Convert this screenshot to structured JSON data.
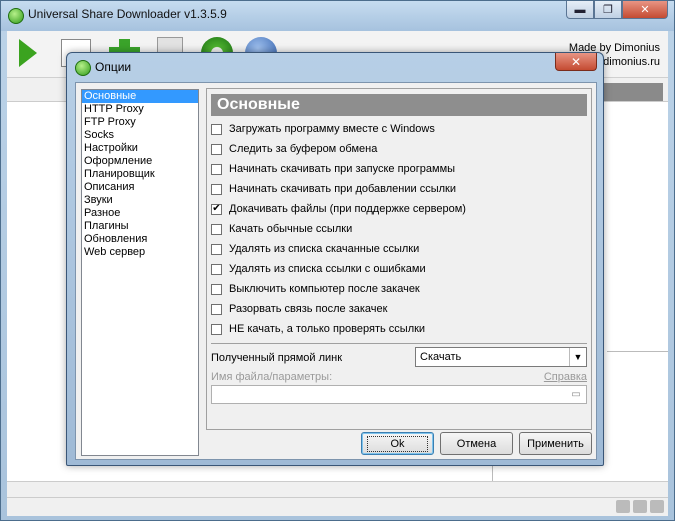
{
  "app": {
    "title": "Universal Share Downloader v1.3.5.9",
    "made_by_line1": "Made by Dimonius",
    "made_by_line2": "dimonius.ru",
    "window_controls": {
      "minimize": "▬",
      "maximize": "❐",
      "close": "✕"
    }
  },
  "toolbar_icons": [
    "play-icon",
    "new-page-icon",
    "add-icon",
    "document-icon",
    "settings-gear-icon",
    "globe-icon"
  ],
  "dialog": {
    "title": "Опции",
    "close": "✕",
    "nav_items": [
      {
        "label": "Основные",
        "selected": true
      },
      {
        "label": "HTTP Proxy"
      },
      {
        "label": "FTP Proxy"
      },
      {
        "label": "Socks"
      },
      {
        "label": "Настройки"
      },
      {
        "label": "Оформление"
      },
      {
        "label": "Планировщик"
      },
      {
        "label": "Описания"
      },
      {
        "label": "Звуки"
      },
      {
        "label": "Разное"
      },
      {
        "label": "Плагины"
      },
      {
        "label": "Обновления"
      },
      {
        "label": "Web сервер"
      }
    ],
    "panel_title": "Основные",
    "options": [
      {
        "label": "Загружать программу вместе с Windows",
        "checked": false
      },
      {
        "label": "Следить за буфером обмена",
        "checked": false
      },
      {
        "label": "Начинать скачивать при запуске программы",
        "checked": false
      },
      {
        "label": "Начинать скачивать при добавлении ссылки",
        "checked": false
      },
      {
        "label": "Докачивать файлы (при поддержке сервером)",
        "checked": true
      },
      {
        "label": "Качать обычные ссылки",
        "checked": false
      },
      {
        "label": "Удалять из списка скачанные ссылки",
        "checked": false
      },
      {
        "label": "Удалять из списка ссылки с ошибками",
        "checked": false
      },
      {
        "label": "Выключить компьютер после закачек",
        "checked": false
      },
      {
        "label": "Разорвать связь после закачек",
        "checked": false
      },
      {
        "label": "НЕ качать, а только проверять ссылки",
        "checked": false
      }
    ],
    "link_label": "Полученный прямой линк",
    "link_select_value": "Скачать",
    "filename_label": "Имя файла/параметры:",
    "help_link": "Справка",
    "filename_value": "",
    "buttons": {
      "ok": "Ok",
      "cancel": "Отмена",
      "apply": "Применить"
    }
  },
  "colors": {
    "selected_nav": "#3399ff",
    "panel_header": "#8e8e8e",
    "close_button": "#c44b32"
  }
}
